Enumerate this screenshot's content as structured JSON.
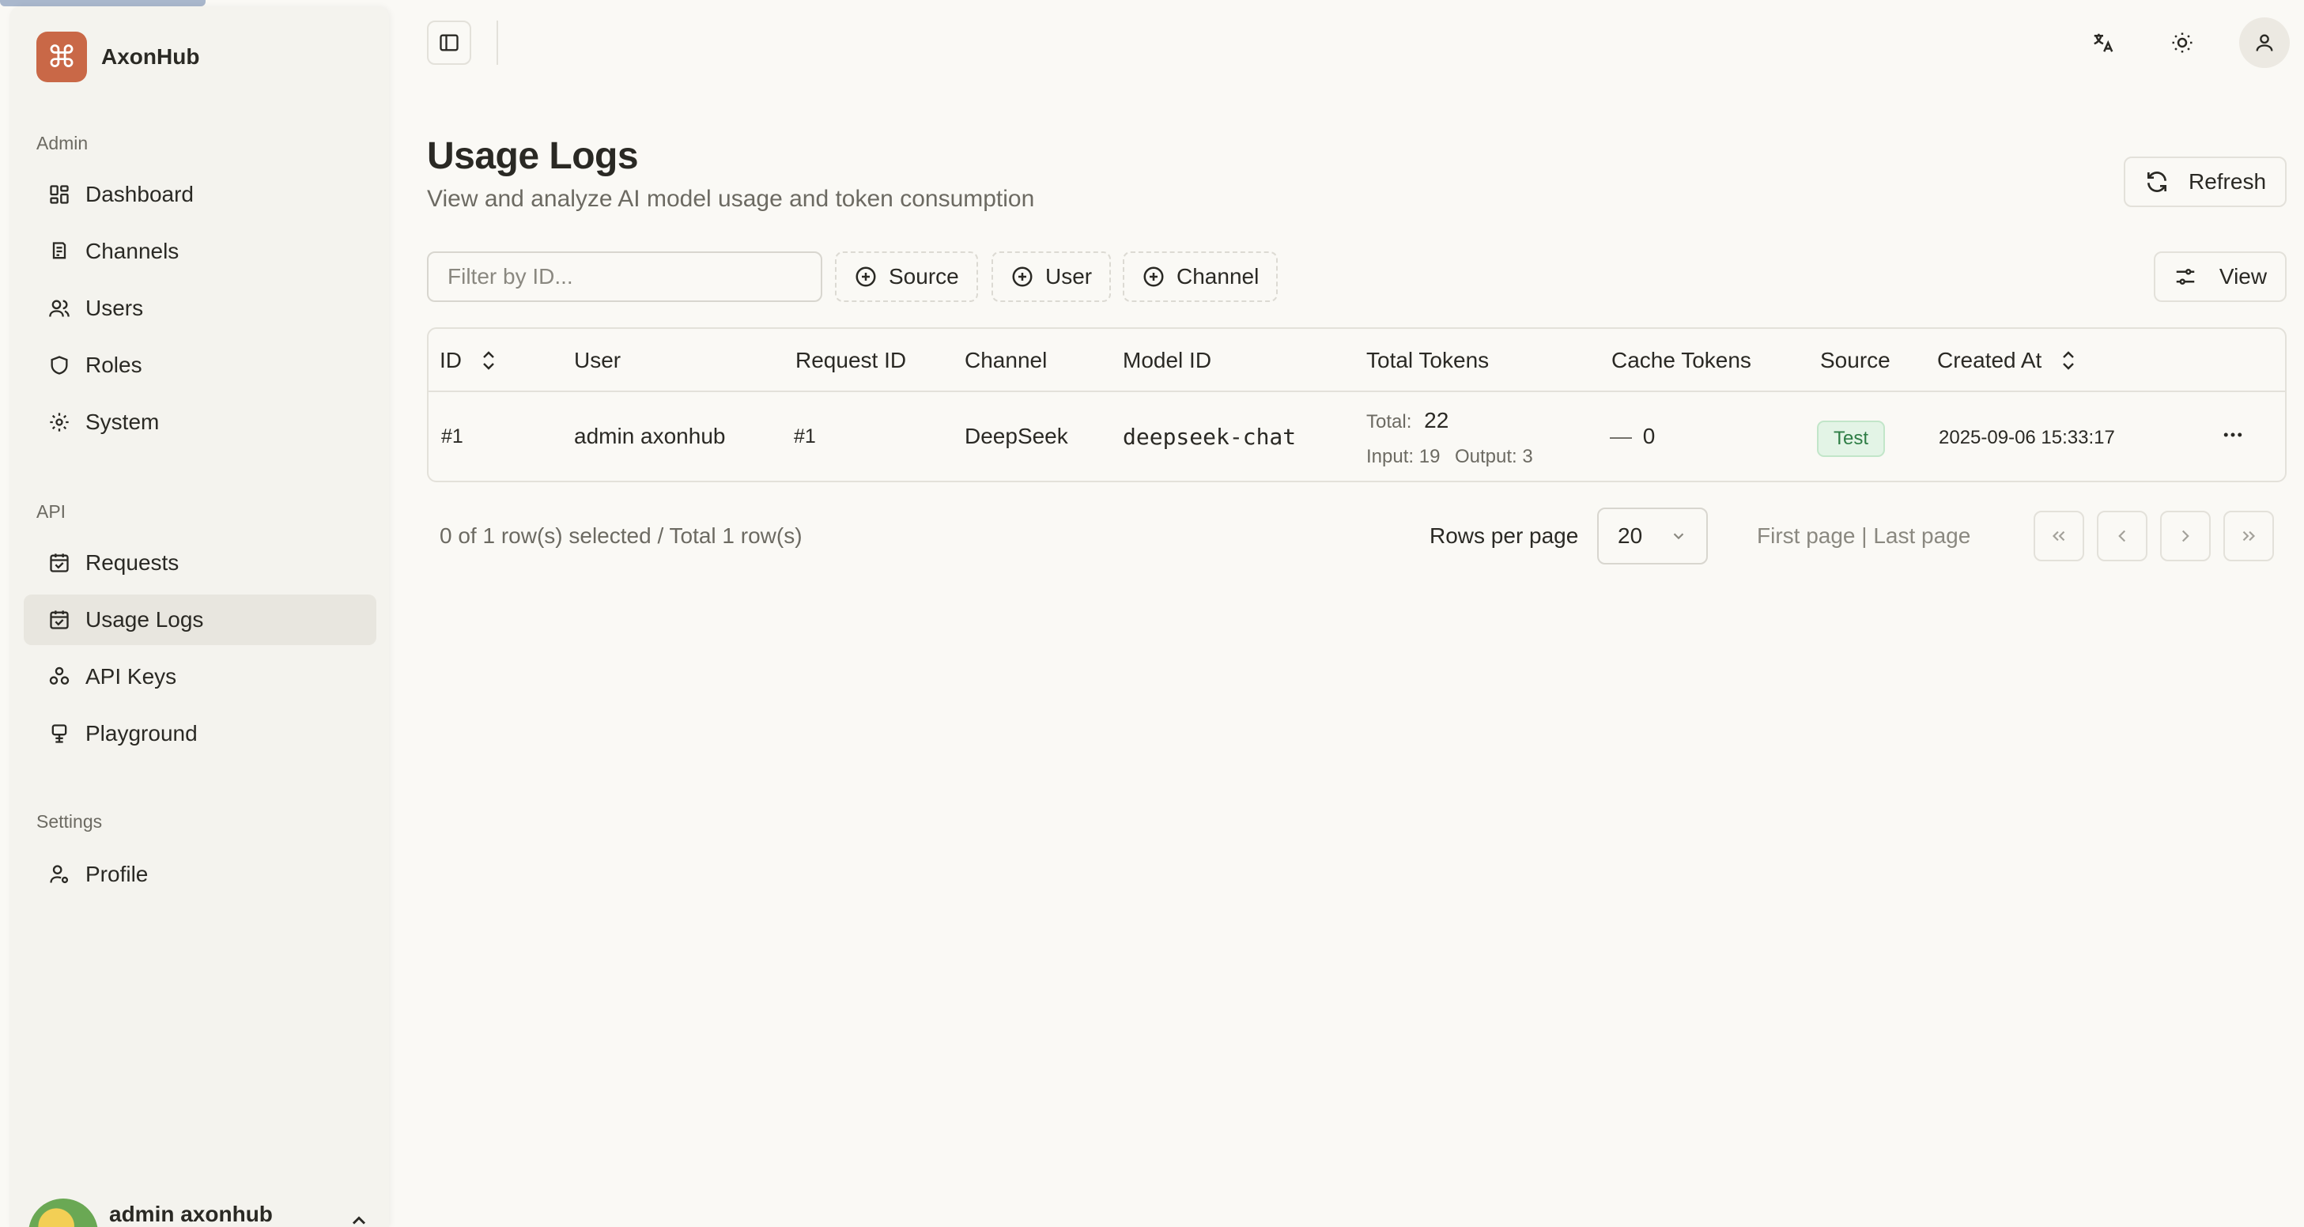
{
  "app": {
    "name": "AxonHub",
    "logo_glyph": "⌘",
    "brand_color": "#c96847"
  },
  "sidebar": {
    "sections": [
      {
        "label": "Admin"
      },
      {
        "label": "API"
      },
      {
        "label": "Settings"
      }
    ],
    "items": [
      {
        "label": "Dashboard",
        "icon": "dashboard-icon"
      },
      {
        "label": "Channels",
        "icon": "channels-icon"
      },
      {
        "label": "Users",
        "icon": "users-icon"
      },
      {
        "label": "Roles",
        "icon": "shield-icon"
      },
      {
        "label": "System",
        "icon": "gear-icon"
      },
      {
        "label": "Requests",
        "icon": "requests-icon"
      },
      {
        "label": "Usage Logs",
        "icon": "usage-logs-icon",
        "active": true
      },
      {
        "label": "API Keys",
        "icon": "api-keys-icon"
      },
      {
        "label": "Playground",
        "icon": "playground-icon"
      },
      {
        "label": "Profile",
        "icon": "profile-icon"
      }
    ],
    "user": {
      "name": "admin axonhub"
    }
  },
  "header": {
    "icons": [
      "sidebar-toggle-icon",
      "translate-icon",
      "sun-icon",
      "user-icon"
    ]
  },
  "page": {
    "title": "Usage Logs",
    "subtitle": "View and analyze AI model usage and token consumption",
    "refresh_label": "Refresh"
  },
  "toolbar": {
    "filter_placeholder": "Filter by ID...",
    "facets": [
      "Source",
      "User",
      "Channel"
    ],
    "view_label": "View"
  },
  "table": {
    "columns": [
      "ID",
      "User",
      "Request ID",
      "Channel",
      "Model ID",
      "Total Tokens",
      "Cache Tokens",
      "Source",
      "Created At"
    ],
    "rows": [
      {
        "id": "#1",
        "user": "admin axonhub",
        "request_id": "#1",
        "channel": "DeepSeek",
        "model_id": "deepseek-chat",
        "total_label": "Total:",
        "total": "22",
        "input_label": "Input: 19",
        "output_label": "Output: 3",
        "cache_prefix": "—",
        "cache": "0",
        "source": "Test",
        "created_at": "2025-09-06 15:33:17"
      }
    ]
  },
  "pagination": {
    "selection_text": "0 of 1 row(s) selected / Total 1 row(s)",
    "rows_per_page_label": "Rows per page",
    "rows_per_page": "20",
    "page_links": "First page | Last page"
  },
  "colors": {
    "background": "#faf9f5",
    "sidebar": "#f4f3ee",
    "badge_bg": "#e3f4e6",
    "badge_text": "#2e7d45"
  }
}
